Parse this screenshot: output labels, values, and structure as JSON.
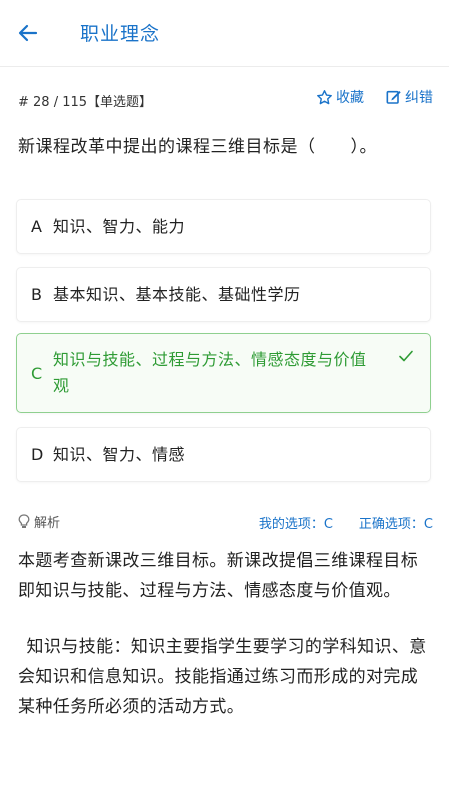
{
  "header": {
    "title": "职业理念",
    "back_icon": "arrow-left-icon"
  },
  "meta": {
    "index": "# 28 / 115【单选题】",
    "favorite_label": "收藏",
    "report_label": "纠错"
  },
  "question": {
    "text": "新课程改革中提出的课程三维目标是（　　）。"
  },
  "options": [
    {
      "letter": "A",
      "text": "知识、智力、能力",
      "correct": false
    },
    {
      "letter": "B",
      "text": "基本知识、基本技能、基础性学历",
      "correct": false
    },
    {
      "letter": "C",
      "text": "知识与技能、过程与方法、情感态度与价值观",
      "correct": true
    },
    {
      "letter": "D",
      "text": "知识、智力、情感",
      "correct": false
    }
  ],
  "analysis": {
    "label": "解析",
    "my_answer": "我的选项：C",
    "correct_answer": "正确选项：C",
    "paragraphs": [
      "本题考查新课改三维目标。新课改提倡三维课程目标即知识与技能、过程与方法、情感态度与价值观。",
      "知识与技能：知识主要指学生要学习的学科知识、意会知识和信息知识。技能指通过练习而形成的对完成某种任务所必须的活动方式。"
    ]
  },
  "colors": {
    "accent": "#1a73c9",
    "correct": "#2e9b34",
    "correct_border": "#8fd08f"
  }
}
